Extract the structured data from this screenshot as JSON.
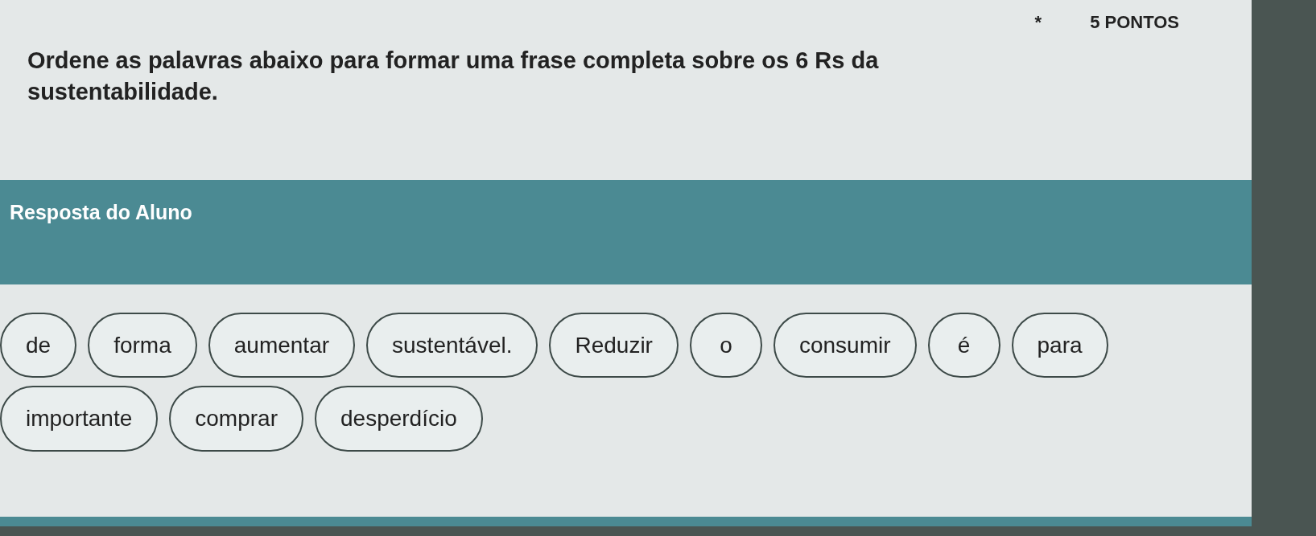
{
  "points": {
    "required_mark": "*",
    "label": "5 PONTOS"
  },
  "question": "Ordene as palavras abaixo para formar uma frase completa sobre os 6 Rs da sustentabilidade.",
  "answer_header": "Resposta do Aluno",
  "words": [
    "de",
    "forma",
    "aumentar",
    "sustentável.",
    "Reduzir",
    "o",
    "consumir",
    "é",
    "para",
    "importante",
    "comprar",
    "desperdício"
  ]
}
